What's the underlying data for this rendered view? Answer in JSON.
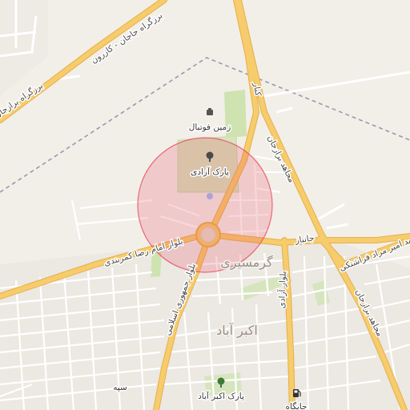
{
  "map": {
    "roads": {
      "north_highway": "برزگراه جاجان - کازرون",
      "west_highway": "برزگراه برازجان",
      "bypass_top": "کنار",
      "bypass_east_1": "مجاهد برازجان",
      "bypass_east_2": "مجاهد برازجان",
      "blvd_west": "بلوار امام رضا کمربندی",
      "blvd_south": "بلوار جمهوری اسلامی",
      "blvd_azadi": "بلوار آزادی",
      "janbaz": "جانباز",
      "farashtaki": "شهید امیر مراد فراشتکی"
    },
    "districts": {
      "garmsiri": "گرمسیری",
      "akbarabad": "اکبر آباد"
    },
    "pois": {
      "stadium": "زمین فوتبال",
      "park_azadi": "پارک آزادی",
      "park_akbarabad": "پارک اکبر آباد",
      "gas_station": "جایگاه",
      "sepah": "سپه"
    },
    "icons": {
      "stadium": "stadium-icon",
      "park_azadi": "tree-icon",
      "park_akbarabad": "tree-icon",
      "gas_station": "fuel-icon",
      "center": "location-pin-icon"
    },
    "colors": {
      "background": "#f2efe9",
      "major_road": "#f6cc6c",
      "major_road_casing": "#e6b04a",
      "minor_road": "#ffffff",
      "park": "#cfe3b0",
      "admin_boundary": "#9b97ad",
      "highlight_circle": "#e84a5f",
      "urban_block": "#ebe7e1"
    }
  }
}
